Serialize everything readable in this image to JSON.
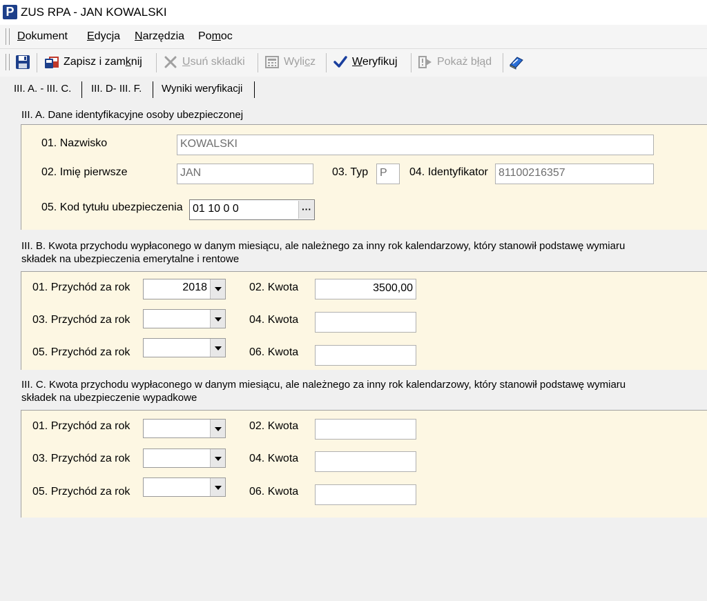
{
  "window": {
    "title": "ZUS RPA - JAN KOWALSKI",
    "logo_letter": "P"
  },
  "menu": {
    "items": [
      {
        "pre": "",
        "u": "D",
        "post": "okument"
      },
      {
        "pre": "",
        "u": "E",
        "post": "dycja"
      },
      {
        "pre": "",
        "u": "N",
        "post": "arzędzia"
      },
      {
        "pre": "Po",
        "u": "m",
        "post": "oc"
      }
    ]
  },
  "toolbar": {
    "save_close": {
      "pre": "Zapisz i zam",
      "u": "k",
      "post": "nij"
    },
    "remove": {
      "pre": "",
      "u": "U",
      "post": "suń składki"
    },
    "calc": {
      "pre": "Wyli",
      "u": "c",
      "post": "z"
    },
    "verify": {
      "pre": "",
      "u": "W",
      "post": "eryfikuj"
    },
    "show_error": {
      "pre": "Pokaż b",
      "u": "ł",
      "post": "ąd"
    },
    "colors": {
      "verify_check": "#1a3f9e",
      "save_icon": "#1d3f8a",
      "disabled": "#a0a0a0"
    }
  },
  "tabs": [
    "III. A. - III. C.",
    "III. D- III. F.",
    "Wyniki weryfikacji"
  ],
  "sectionA": {
    "title": "III. A. Dane identyfikacyjne osoby ubezpieczonej",
    "f01_label": "01. Nazwisko",
    "f01_value": "KOWALSKI",
    "f02_label": "02. Imię pierwsze",
    "f02_value": "JAN",
    "f03_label": "03. Typ",
    "f03_value": "P",
    "f04_label": "04. Identyfikator",
    "f04_value": "81100216357",
    "f05_label": "05. Kod tytułu ubezpieczenia",
    "f05_value": "01 10 0 0",
    "f05_button": "···"
  },
  "sectionB": {
    "title_line1": "III. B. Kwota przychodu wypłaconego w danym miesiącu, ale należnego za inny rok kalendarzowy, który  stanowił podstawę wymiaru",
    "title_line2": "składek na ubezpieczenia emerytalne i rentowe",
    "rows": [
      {
        "year_label": "01. Przychód za  rok",
        "year": "2018",
        "amount_label": "02. Kwota",
        "amount": "3500,00"
      },
      {
        "year_label": "03. Przychód za  rok",
        "year": "",
        "amount_label": "04. Kwota",
        "amount": ""
      },
      {
        "year_label": "05. Przychód za  rok",
        "year": "",
        "amount_label": "06. Kwota",
        "amount": ""
      }
    ]
  },
  "sectionC": {
    "title_line1": "III. C. Kwota przychodu wypłaconego w danym miesiącu, ale należnego za inny rok kalendarzowy, który stanowił podstawę wymiaru",
    "title_line2": "składek na ubezpieczenie wypadkowe",
    "rows": [
      {
        "year_label": "01. Przychód za  rok",
        "year": "",
        "amount_label": "02. Kwota",
        "amount": ""
      },
      {
        "year_label": "03. Przychód za  rok",
        "year": "",
        "amount_label": "04. Kwota",
        "amount": ""
      },
      {
        "year_label": "05. Przychód za  rok",
        "year": "",
        "amount_label": "06. Kwota",
        "amount": ""
      }
    ]
  }
}
